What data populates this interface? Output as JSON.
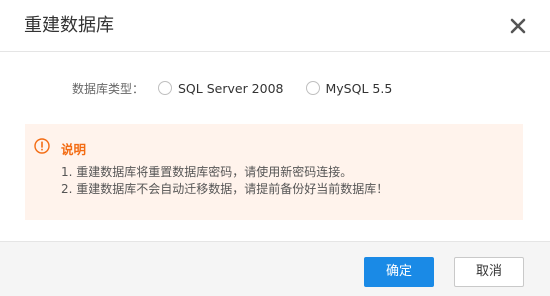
{
  "dialog": {
    "title": "重建数据库",
    "close_icon": "close-icon"
  },
  "db_type": {
    "label": "数据库类型：",
    "options": [
      {
        "label": "SQL Server 2008",
        "selected": false
      },
      {
        "label": "MySQL 5.5",
        "selected": false
      }
    ]
  },
  "notice": {
    "icon": "exclamation-circle-icon",
    "title": "说明",
    "items": [
      "1. 重建数据库将重置数据库密码，请使用新密码连接。",
      "2. 重建数据库不会自动迁移数据，请提前备份好当前数据库！"
    ],
    "background": "#fff3ec",
    "accent": "#f36b12"
  },
  "footer": {
    "confirm_label": "确定",
    "cancel_label": "取消",
    "primary_color": "#1a8ae6"
  }
}
